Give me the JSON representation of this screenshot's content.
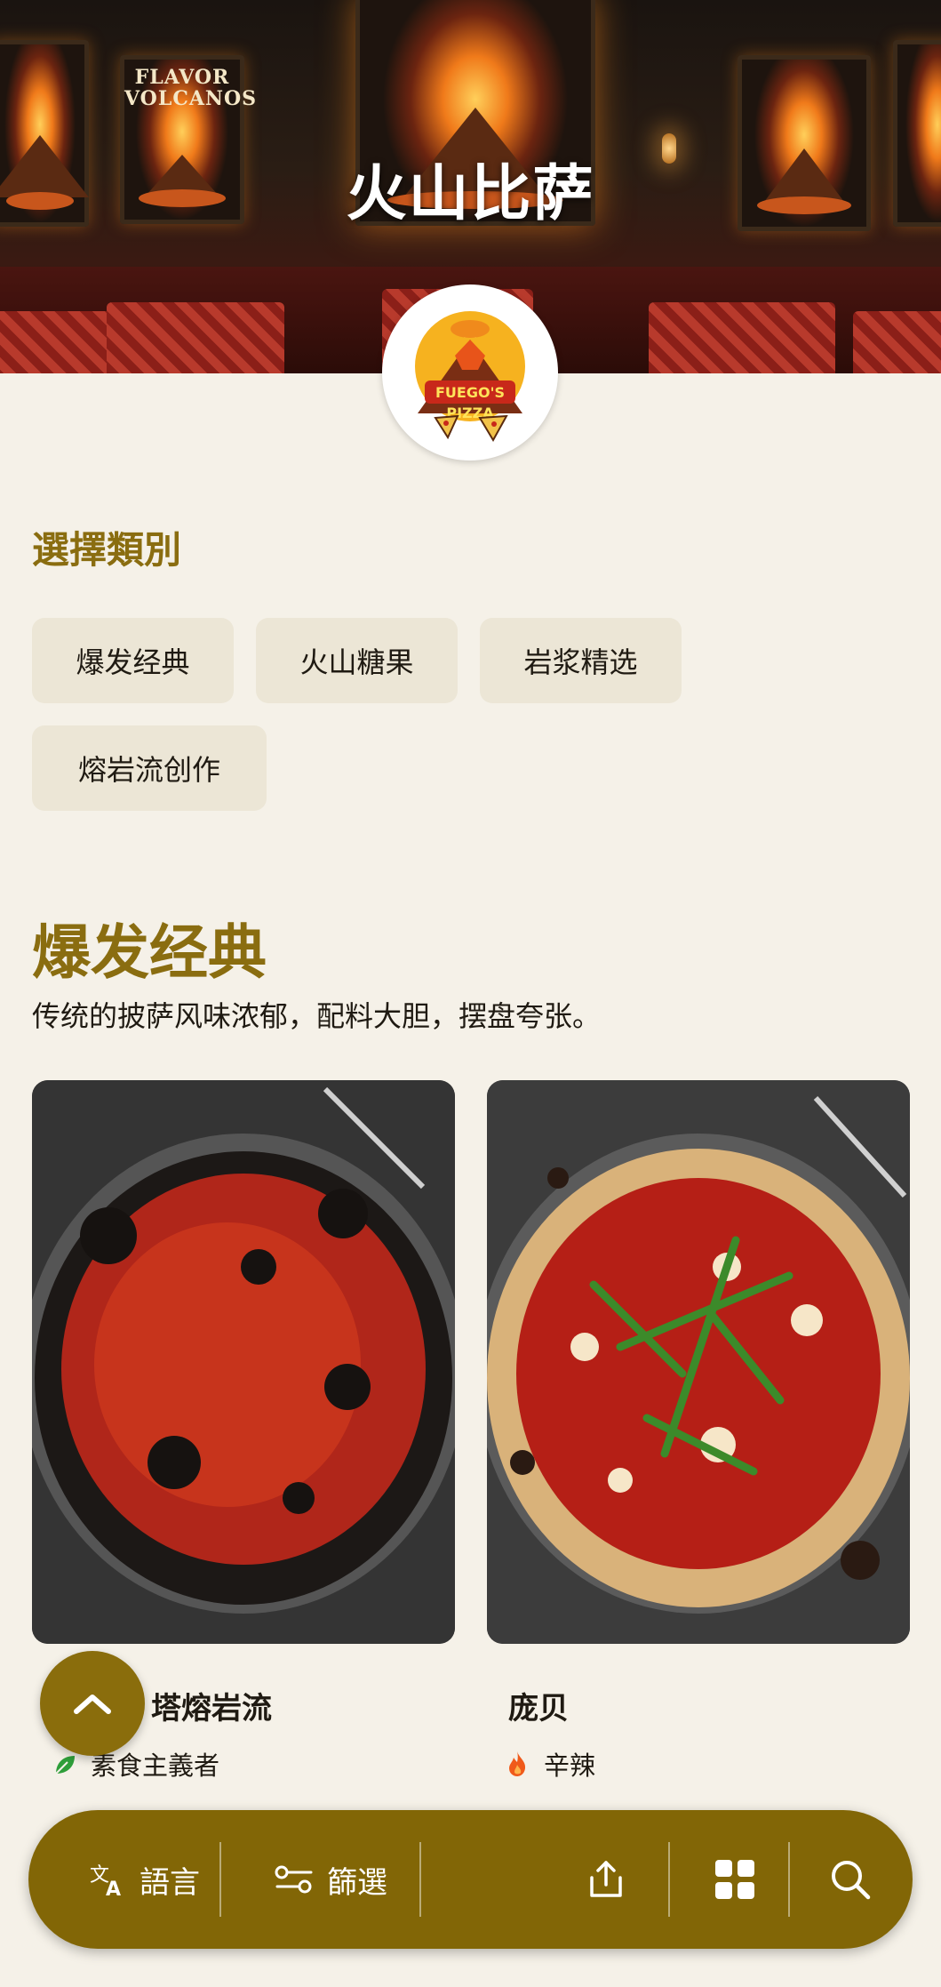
{
  "hero": {
    "title": "火山比萨",
    "poster_text": "FLAVOR VOLCANOS"
  },
  "logo": {
    "name": "FUEGO'S PIZZA",
    "icon": "volcano-pizza-logo"
  },
  "category_picker": {
    "heading": "選擇類別",
    "chips": [
      "爆发经典",
      "火山糖果",
      "岩浆精选",
      "熔岩流创作"
    ]
  },
  "section": {
    "title": "爆发经典",
    "description": "传统的披萨风味浓郁，配料大胆，摆盘夸张。",
    "items": [
      {
        "title": "塔熔岩流",
        "tag": "素食主義者",
        "tag_icon": "leaf-icon"
      },
      {
        "title": "庞贝",
        "tag": "辛辣",
        "tag_icon": "fire-icon"
      }
    ]
  },
  "bottom_bar": {
    "language_label": "語言",
    "filter_label": "篩選",
    "share_icon": "share-icon",
    "grid_icon": "grid-icon",
    "search_icon": "search-icon"
  },
  "colors": {
    "accent": "#826606",
    "heading": "#8a6d10",
    "background": "#f5f1e8",
    "chip": "#ece6d6"
  }
}
